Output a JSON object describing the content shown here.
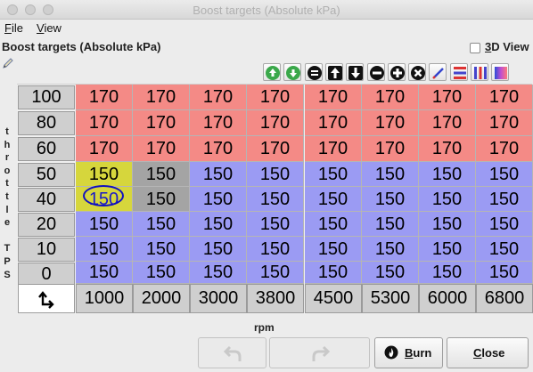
{
  "window": {
    "title": "Boost targets (Absolute kPa)"
  },
  "menu": {
    "file": "File",
    "view": "View"
  },
  "panel": {
    "title": "Boost targets (Absolute kPa)",
    "view3d_label": "3D View",
    "view3d_checked": false
  },
  "toolbar": {
    "icons": [
      "increase-fine-icon",
      "decrease-fine-icon",
      "set-value-icon",
      "shift-up-icon",
      "shift-down-icon",
      "subtract-icon",
      "add-icon",
      "multiply-icon",
      "interpolate-icon",
      "interpolate-horizontal-icon",
      "interpolate-vertical-icon",
      "color-map-icon"
    ]
  },
  "table": {
    "y_axis_label": "throttle TPS",
    "x_axis_label": "rpm",
    "rows": [
      "100",
      "80",
      "60",
      "50",
      "40",
      "20",
      "10",
      "0"
    ],
    "cols": [
      "1000",
      "2000",
      "3000",
      "3800",
      "4500",
      "5300",
      "6000",
      "6800"
    ],
    "values": [
      [
        "170",
        "170",
        "170",
        "170",
        "170",
        "170",
        "170",
        "170"
      ],
      [
        "170",
        "170",
        "170",
        "170",
        "170",
        "170",
        "170",
        "170"
      ],
      [
        "170",
        "170",
        "170",
        "170",
        "170",
        "170",
        "170",
        "170"
      ],
      [
        "150",
        "150",
        "150",
        "150",
        "150",
        "150",
        "150",
        "150"
      ],
      [
        "150",
        "150",
        "150",
        "150",
        "150",
        "150",
        "150",
        "150"
      ],
      [
        "150",
        "150",
        "150",
        "150",
        "150",
        "150",
        "150",
        "150"
      ],
      [
        "150",
        "150",
        "150",
        "150",
        "150",
        "150",
        "150",
        "150"
      ],
      [
        "150",
        "150",
        "150",
        "150",
        "150",
        "150",
        "150",
        "150"
      ]
    ],
    "colors": {
      "high": "#f48a86",
      "low": "#9b9bf3",
      "selected": "#d6d63c",
      "highlight": "#a4a4a4"
    }
  },
  "buttons": {
    "undo": "",
    "redo": "",
    "burn": "Burn",
    "close": "Close"
  }
}
